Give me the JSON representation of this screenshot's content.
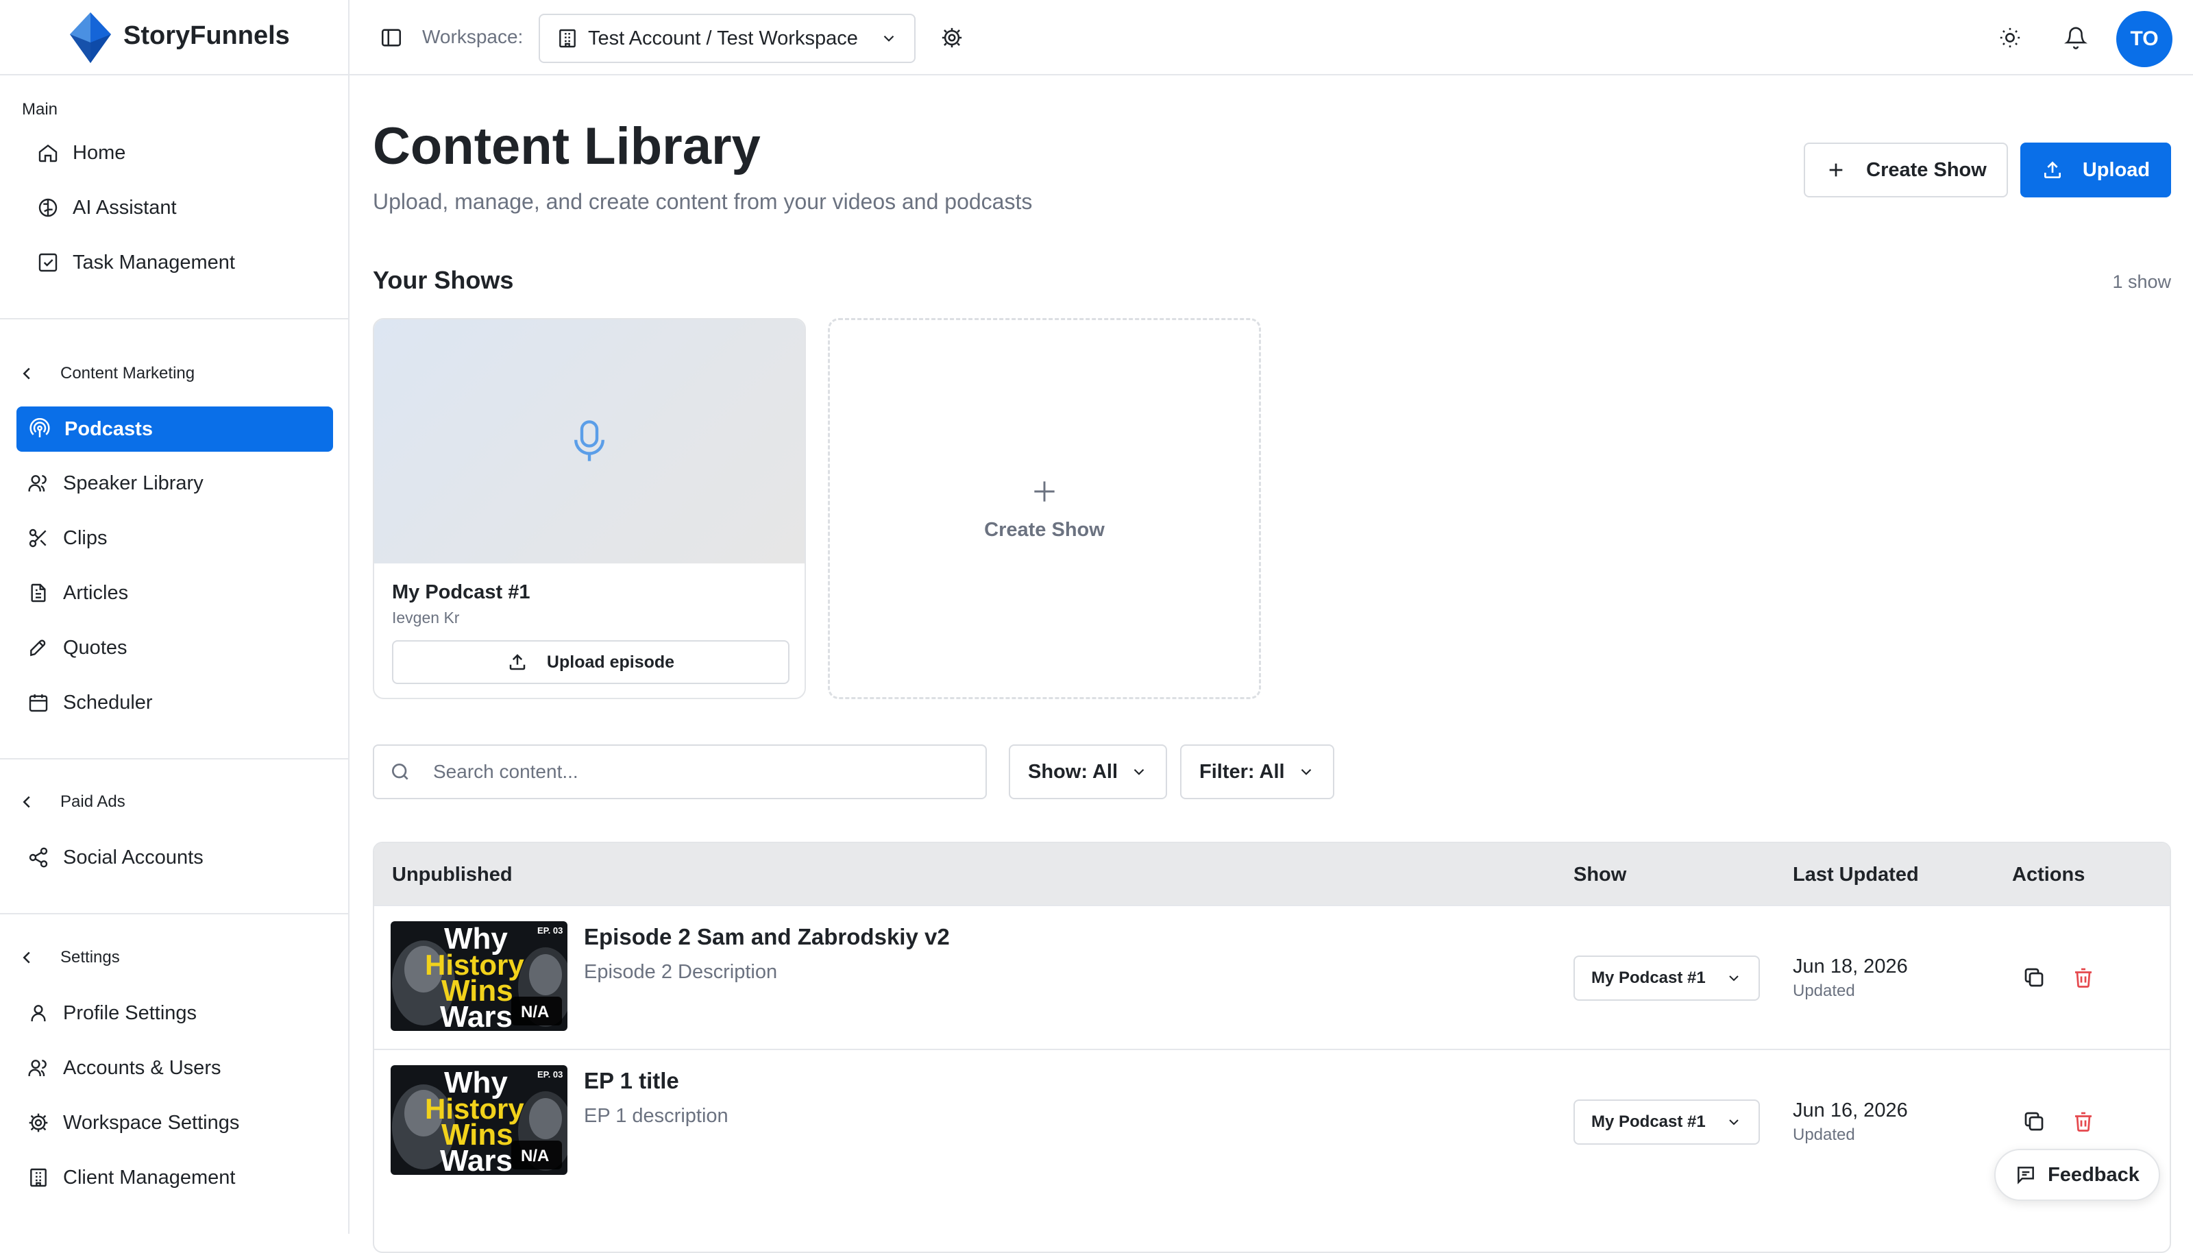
{
  "brand": {
    "name": "StoryFunnels"
  },
  "sidebar": {
    "main_label": "Main",
    "main_items": [
      {
        "label": "Home",
        "icon": "home-icon"
      },
      {
        "label": "AI Assistant",
        "icon": "brain-icon"
      },
      {
        "label": "Task Management",
        "icon": "checkbox-icon"
      }
    ],
    "content_marketing": {
      "label": "Content Marketing",
      "items": [
        {
          "label": "Podcasts",
          "icon": "podcast-icon",
          "active": true
        },
        {
          "label": "Speaker Library",
          "icon": "users-icon"
        },
        {
          "label": "Clips",
          "icon": "scissors-icon"
        },
        {
          "label": "Articles",
          "icon": "document-icon"
        },
        {
          "label": "Quotes",
          "icon": "quote-icon"
        },
        {
          "label": "Scheduler",
          "icon": "calendar-icon"
        }
      ]
    },
    "paid_ads": {
      "label": "Paid Ads",
      "items": [
        {
          "label": "Social Accounts",
          "icon": "share-icon"
        }
      ]
    },
    "settings": {
      "label": "Settings",
      "items": [
        {
          "label": "Profile Settings",
          "icon": "user-icon"
        },
        {
          "label": "Accounts & Users",
          "icon": "users-icon"
        },
        {
          "label": "Workspace Settings",
          "icon": "gear-icon"
        },
        {
          "label": "Client Management",
          "icon": "building-icon"
        }
      ]
    }
  },
  "topbar": {
    "workspace_label": "Workspace:",
    "workspace_value": "Test Account / Test Workspace",
    "avatar_initials": "TO"
  },
  "page": {
    "title": "Content Library",
    "subtitle": "Upload, manage, and create content from your videos and podcasts",
    "create_show_button": "Create Show",
    "upload_button": "Upload"
  },
  "shows": {
    "title": "Your Shows",
    "count": "1 show",
    "cards": [
      {
        "name": "My Podcast #1",
        "owner": "Ievgen Kr",
        "upload_label": "Upload episode"
      }
    ],
    "create_card_label": "Create Show"
  },
  "filters": {
    "search_placeholder": "Search content...",
    "show_filter": "Show: All",
    "filter": "Filter: All"
  },
  "table": {
    "headers": {
      "title": "Unpublished",
      "show": "Show",
      "updated": "Last Updated",
      "actions": "Actions"
    },
    "rows": [
      {
        "title": "Episode 2 Sam and Zabrodskiy v2",
        "description": "Episode 2 Description",
        "show": "My Podcast #1",
        "date": "Jun 18, 2026",
        "updated_label": "Updated",
        "thumb": {
          "line1": "Why",
          "line2": "History",
          "line3": "Wins",
          "line4": "Wars",
          "ep": "EP. 03",
          "badge": "N/A"
        }
      },
      {
        "title": "EP 1 title",
        "description": "EP 1 description",
        "show": "My Podcast #1",
        "date": "Jun 16, 2026",
        "updated_label": "Updated",
        "thumb": {
          "line1": "Why",
          "line2": "History",
          "line3": "Wins",
          "line4": "Wars",
          "ep": "EP. 03",
          "badge": "N/A"
        }
      }
    ]
  },
  "feedback": {
    "label": "Feedback"
  },
  "colors": {
    "accent": "#0a6fe8",
    "danger": "#e5484d",
    "muted": "#6b7280"
  }
}
